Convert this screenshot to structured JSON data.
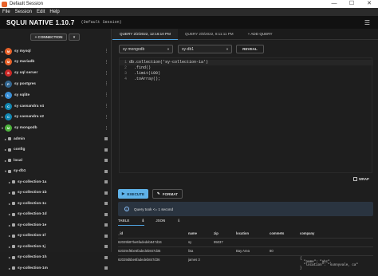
{
  "window": {
    "title": "Default Session",
    "controls": [
      "—",
      "☐",
      "✕"
    ]
  },
  "menu": [
    "File",
    "Session",
    "Edit",
    "Help"
  ],
  "header": {
    "brand": "SQLUI NATIVE 1.10.7",
    "session": "(Default Session)"
  },
  "sidebar": {
    "connection_button": "+ CONNECTION",
    "connection_more": "▾",
    "connections": [
      {
        "label": "sy mysql",
        "color": "#e8632b",
        "glyph": "M"
      },
      {
        "label": "sy mariadb",
        "color": "#e8632b",
        "glyph": "M"
      },
      {
        "label": "sy sql server",
        "color": "#cc2927",
        "glyph": "S"
      },
      {
        "label": "sy postgres",
        "color": "#336791",
        "glyph": "P"
      },
      {
        "label": "sy sqlite",
        "color": "#3a8fd6",
        "glyph": "L"
      },
      {
        "label": "sy cassandra v4",
        "color": "#1287b1",
        "glyph": "C"
      },
      {
        "label": "sy cassandra v2",
        "color": "#1287b1",
        "glyph": "C"
      },
      {
        "label": "sy mongodb",
        "color": "#4db33d",
        "glyph": "M"
      }
    ],
    "databases": [
      "admin",
      "config",
      "local",
      "sy-db1"
    ],
    "collections": [
      "sy-collection-1a",
      "sy-collection-1b",
      "sy-collection-1c",
      "sy-collection-1d",
      "sy-collection-1e",
      "sy-collection-1f",
      "sy-collection-1j",
      "sy-collection-1h",
      "sy-collection-1m"
    ]
  },
  "tabs": [
    {
      "label": "QUERY 2/2/2022, 12:16:10 PM",
      "active": true
    },
    {
      "label": "QUERY 2/8/2022, 8:11:11 PM",
      "active": false
    },
    {
      "label": "+ ADD QUERY",
      "active": false
    }
  ],
  "query": {
    "connection": "sy mongodb",
    "database": "sy-db1",
    "reveal_label": "REVEAL",
    "lines": [
      "db.collection('sy-collection-1a')",
      "  .find()",
      "  .limit(100)",
      "  .toArray();"
    ],
    "wrap_label": "WRAP",
    "execute_label": "EXECUTE",
    "format_label": "FORMAT",
    "status": "Query took <= 1 second"
  },
  "results": {
    "tabs": [
      "TABLE",
      "JSON"
    ],
    "columns": [
      "_id",
      "name",
      "zip",
      "location",
      "commets",
      "company"
    ],
    "rows": [
      [
        "62029b87be6fadedeb847d34",
        "sy",
        "95037",
        "",
        "",
        ""
      ],
      [
        "62029cf8be6fadedeb847d35",
        "lisa",
        "",
        "Bay Area",
        "80",
        ""
      ],
      [
        "62029d5be6fadedeb847d36",
        "james 3",
        "",
        "",
        "",
        "{\n  \"name\": \"abc\",\n  \"location\": \"sunnyvale, ca\"\n}"
      ]
    ]
  }
}
